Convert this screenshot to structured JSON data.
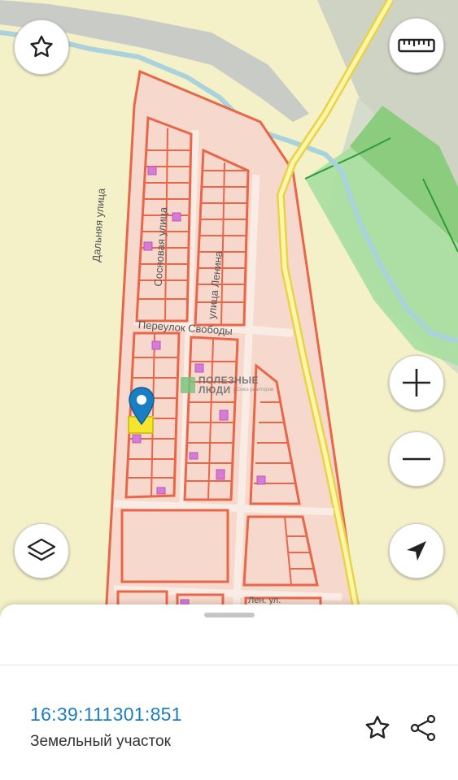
{
  "map": {
    "street_labels": [
      "Дальняя улица",
      "Сосновая улица",
      "улица Ленина",
      "Переулок Свободы",
      "Лен. ул."
    ],
    "watermark": {
      "title_line1": "ПОЛЕЗНЫЕ",
      "title_line2": "ЛЮДИ",
      "subtitle": "Союз риэлторов"
    }
  },
  "controls": {
    "favorite_icon": "star-outline-icon",
    "ruler_icon": "ruler-icon",
    "zoom_in_icon": "plus-icon",
    "zoom_out_icon": "minus-icon",
    "layers_icon": "layers-icon",
    "locate_icon": "navigation-arrow-icon"
  },
  "object": {
    "cadastral_number": "16:39:111301:851",
    "type": "Земельный участок"
  },
  "colors": {
    "accent": "#1a7ec2",
    "parcel_border": "#e8664a",
    "parcel_fill": "#f6d9cc",
    "selected_parcel": "#f5e52c",
    "forest": "#8fd08a"
  }
}
